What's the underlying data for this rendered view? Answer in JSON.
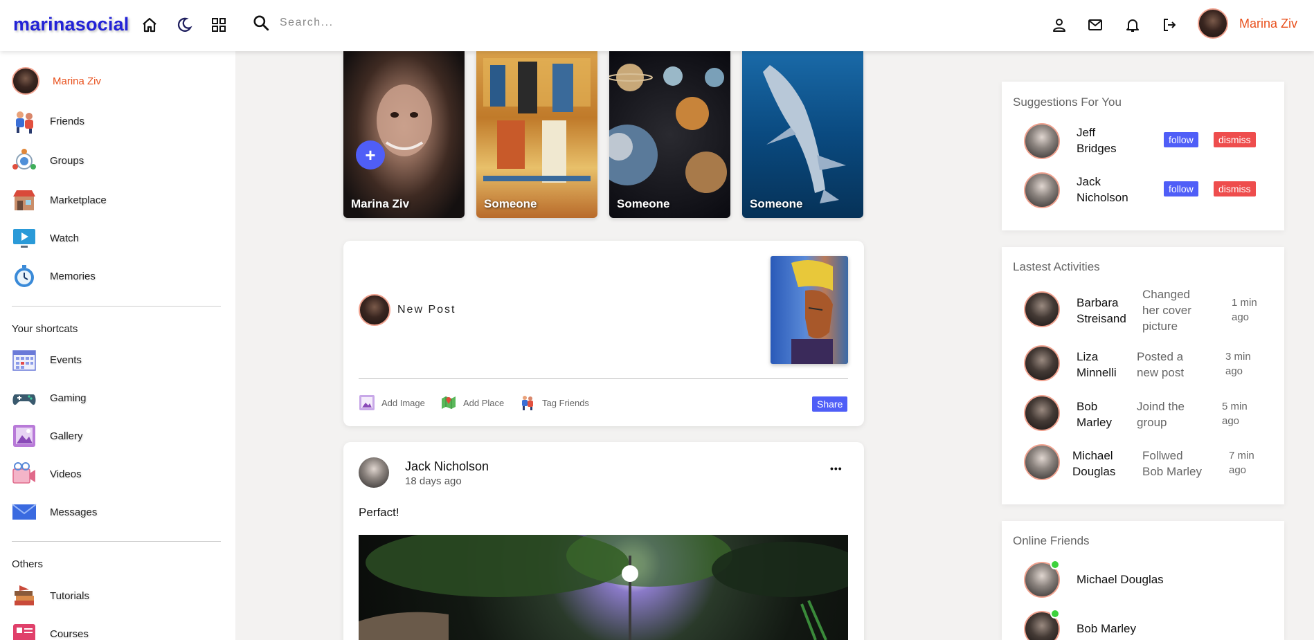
{
  "navbar": {
    "logo": "marinasocial",
    "search_placeholder": "Search...",
    "user_name": "Marina Ziv"
  },
  "sidebar": {
    "profile_name": "Marina Ziv",
    "main_items": [
      {
        "label": "Friends",
        "icon": "friends-icon"
      },
      {
        "label": "Groups",
        "icon": "groups-icon"
      },
      {
        "label": "Marketplace",
        "icon": "marketplace-icon"
      },
      {
        "label": "Watch",
        "icon": "watch-icon"
      },
      {
        "label": "Memories",
        "icon": "memories-icon"
      }
    ],
    "shortcuts_heading": "Your shortcats",
    "shortcut_items": [
      {
        "label": "Events",
        "icon": "events-icon"
      },
      {
        "label": "Gaming",
        "icon": "gaming-icon"
      },
      {
        "label": "Gallery",
        "icon": "gallery-icon"
      },
      {
        "label": "Videos",
        "icon": "videos-icon"
      },
      {
        "label": "Messages",
        "icon": "messages-icon"
      }
    ],
    "others_heading": "Others",
    "other_items": [
      {
        "label": "Tutorials",
        "icon": "tutorials-icon"
      },
      {
        "label": "Courses",
        "icon": "courses-icon"
      }
    ]
  },
  "stories": [
    {
      "name": "Marina Ziv"
    },
    {
      "name": "Someone"
    },
    {
      "name": "Someone"
    },
    {
      "name": "Someone"
    }
  ],
  "new_post": {
    "label": "New Post",
    "actions": {
      "add_image": "Add Image",
      "add_place": "Add Place",
      "tag_friends": "Tag Friends"
    },
    "share": "Share"
  },
  "post": {
    "author": "Jack Nicholson",
    "time": "18 days ago",
    "text": "Perfact!",
    "more": "•••"
  },
  "suggestions": {
    "title": "Suggestions For You",
    "items": [
      {
        "name_line1": "Jeff",
        "name_line2": "Bridges",
        "follow": "follow",
        "dismiss": "dismiss"
      },
      {
        "name_line1": "Jack",
        "name_line2": "Nicholson",
        "follow": "follow",
        "dismiss": "dismiss"
      }
    ]
  },
  "activities": {
    "title": "Lastest Activities",
    "items": [
      {
        "name_line1": "Barbara",
        "name_line2": "Streisand",
        "act_line1": "Changed",
        "act_line2": "her cover",
        "act_line3": "picture",
        "time_line1": "1 min",
        "time_line2": "ago"
      },
      {
        "name_line1": "Liza",
        "name_line2": "Minnelli",
        "act_line1": "Posted a",
        "act_line2": "new post",
        "act_line3": "",
        "time_line1": "3 min",
        "time_line2": "ago"
      },
      {
        "name_line1": "Bob",
        "name_line2": "Marley",
        "act_line1": "Joind the",
        "act_line2": "group",
        "act_line3": "",
        "time_line1": "5 min",
        "time_line2": "ago"
      },
      {
        "name_line1": "Michael",
        "name_line2": "Douglas",
        "act_line1": "Follwed",
        "act_line2": "Bob Marley",
        "act_line3": "",
        "time_line1": "7 min",
        "time_line2": "ago"
      }
    ]
  },
  "online": {
    "title": "Online Friends",
    "items": [
      {
        "name": "Michael Douglas"
      },
      {
        "name": "Bob Marley"
      }
    ]
  },
  "colors": {
    "brand": "#2323d6",
    "accent": "#4f5ef7",
    "user_name": "#e8501c",
    "dismiss": "#ee4d4d",
    "online": "#3dd23d"
  }
}
